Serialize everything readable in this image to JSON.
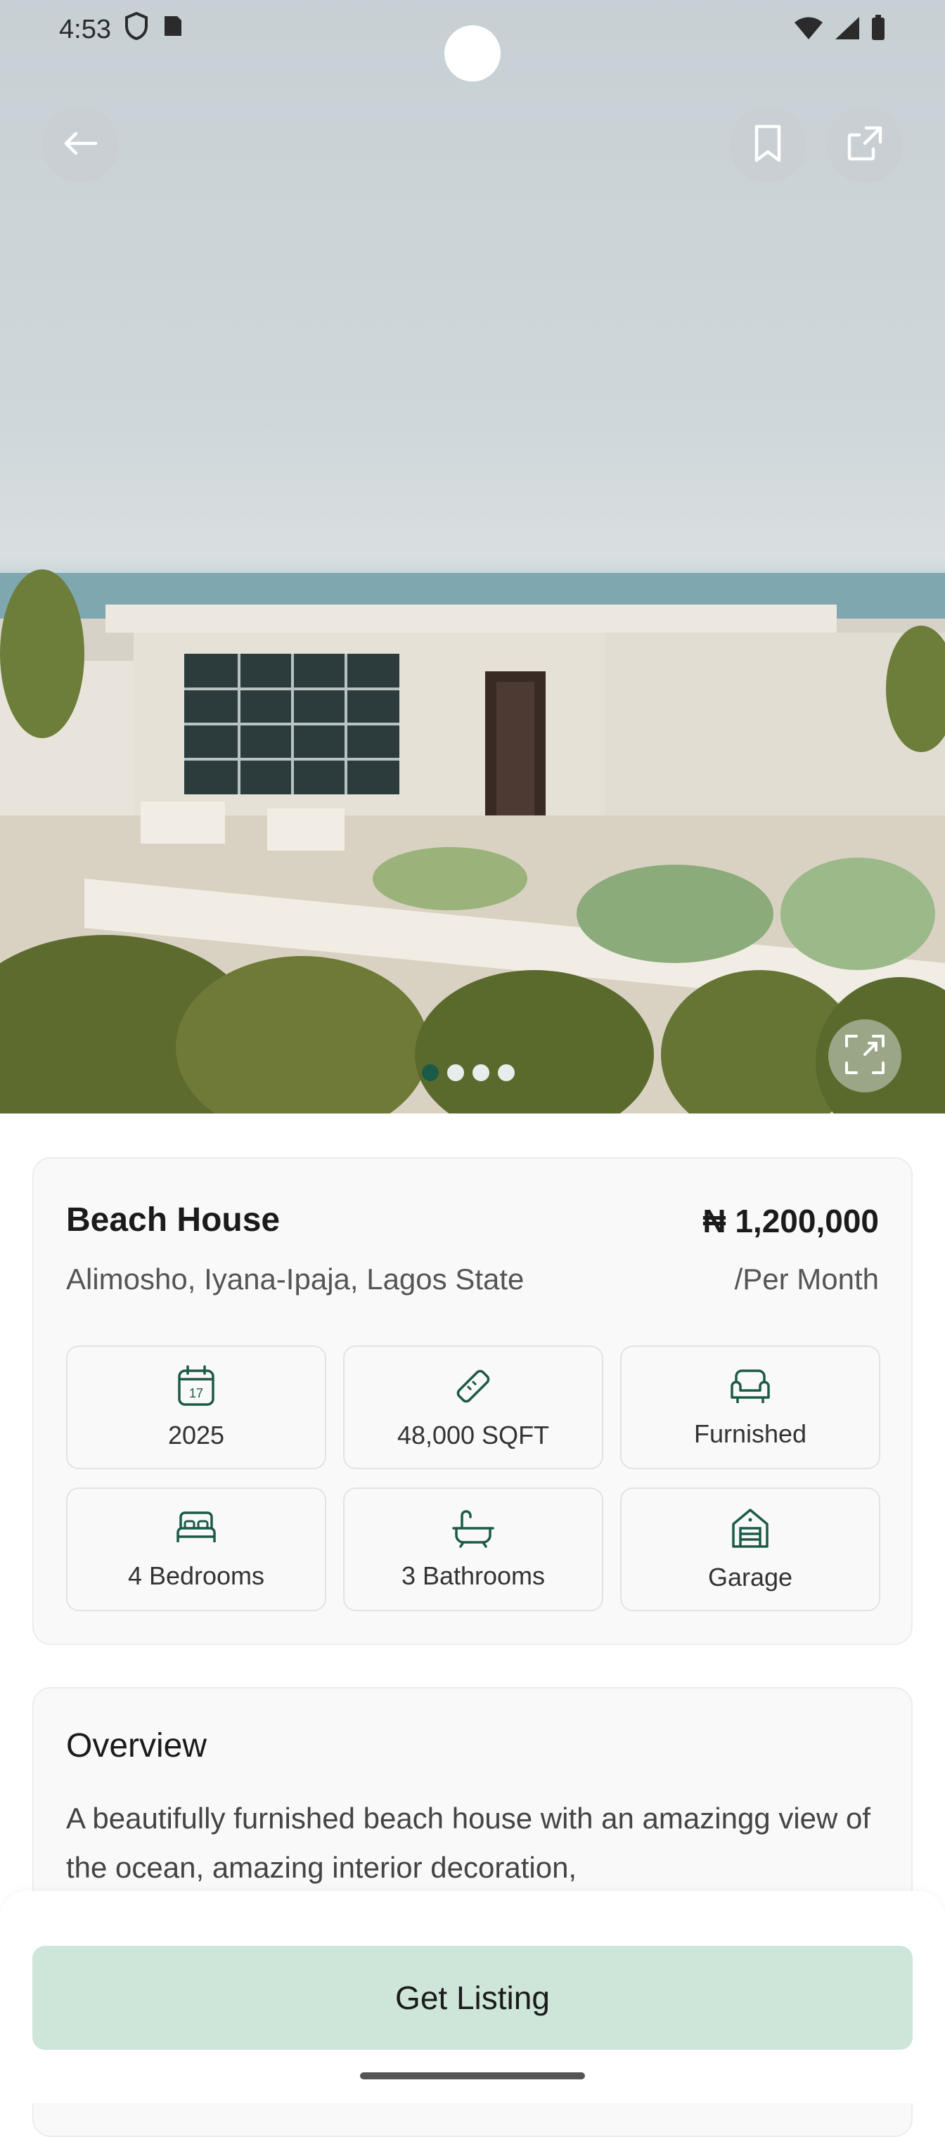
{
  "status_bar": {
    "time": "4:53"
  },
  "hero": {
    "image_description_icon": "beach-house-photo",
    "carousel_count": 4,
    "carousel_active": 0
  },
  "listing": {
    "title": "Beach House",
    "price": "₦ 1,200,000",
    "location": "Alimosho, Iyana-Ipaja, Lagos State",
    "period": "/Per Month",
    "features": [
      {
        "icon": "calendar-icon",
        "label": "2025"
      },
      {
        "icon": "ruler-icon",
        "label": "48,000 SQFT"
      },
      {
        "icon": "sofa-icon",
        "label": "Furnished"
      },
      {
        "icon": "bed-icon",
        "label": "4 Bedrooms"
      },
      {
        "icon": "bathtub-icon",
        "label": "3 Bathrooms"
      },
      {
        "icon": "garage-icon",
        "label": "Garage"
      }
    ],
    "calendar_day": "17"
  },
  "overview": {
    "title": "Overview",
    "text": "A beautifully furnished beach house with an amazingg view of the ocean, amazing interior decoration,"
  },
  "cta": {
    "label": "Get Listing"
  },
  "colors": {
    "accent": "#1c5a48",
    "cta_bg": "#cde6d9"
  }
}
